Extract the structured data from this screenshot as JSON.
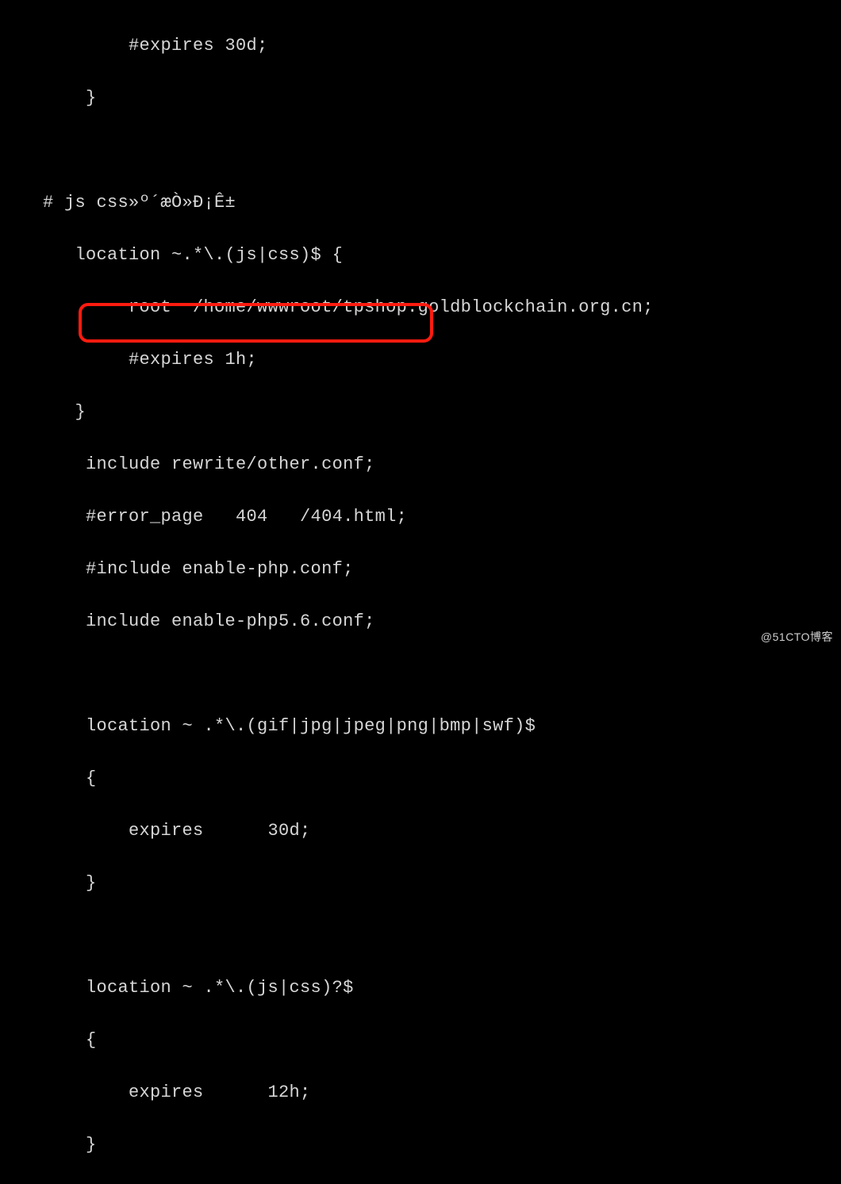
{
  "code": {
    "lines": [
      "            #expires 30d;",
      "        }",
      "",
      "    # js css»º´æÒ»Ð¡Ê±",
      "       location ~.*\\.(js|css)$ {",
      "            root  /home/wwwroot/tpshop.goldblockchain.org.cn;",
      "            #expires 1h;",
      "       }",
      "        include rewrite/other.conf;",
      "        #error_page   404   /404.html;",
      "        #include enable-php.conf;",
      "        include enable-php5.6.conf;",
      "",
      "        location ~ .*\\.(gif|jpg|jpeg|png|bmp|swf)$",
      "        {",
      "            expires      30d;",
      "        }",
      "",
      "        location ~ .*\\.(js|css)?$",
      "        {",
      "            expires      12h;",
      "        }"
    ]
  },
  "highlight": {
    "target_line_index": 11
  },
  "watermark": "@51CTO博客"
}
